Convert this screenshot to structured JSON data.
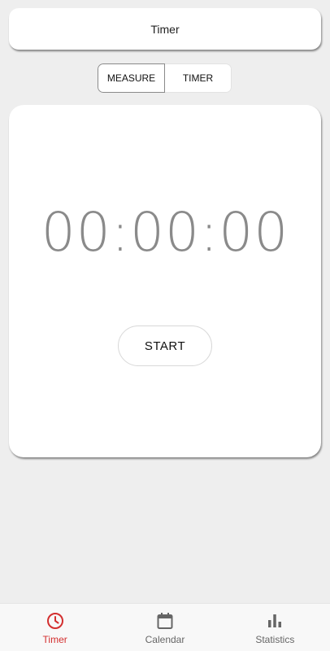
{
  "header": {
    "title": "Timer"
  },
  "mode_toggle": {
    "measure_label": "MEASURE",
    "timer_label": "TIMER",
    "selected": "MEASURE"
  },
  "timer": {
    "display": "00:00:00",
    "start_label": "START"
  },
  "bottom_nav": {
    "items": [
      {
        "label": "Timer",
        "icon": "clock-icon",
        "active": true
      },
      {
        "label": "Calendar",
        "icon": "calendar-icon",
        "active": false
      },
      {
        "label": "Statistics",
        "icon": "bar-chart-icon",
        "active": false
      }
    ]
  },
  "colors": {
    "accent": "#d32f2f",
    "icon_gray": "#666666",
    "digits": "#8a8a8a",
    "background": "#eeeeee"
  }
}
